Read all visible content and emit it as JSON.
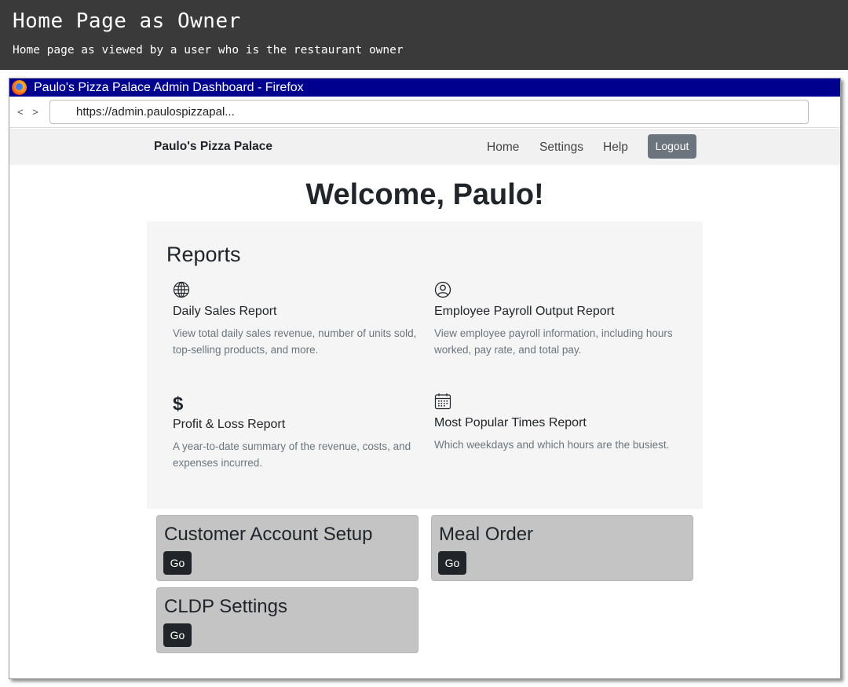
{
  "doc": {
    "title": "Home Page as Owner",
    "subtitle": "Home page as viewed by a user who is the restaurant owner"
  },
  "window": {
    "title": "Paulo's Pizza Palace Admin Dashboard - Firefox",
    "nav_arrows": "< >",
    "url": "https://admin.paulospizzapal..."
  },
  "navbar": {
    "brand": "Paulo's Pizza Palace",
    "links": [
      "Home",
      "Settings",
      "Help"
    ],
    "logout": "Logout"
  },
  "welcome": "Welcome, Paulo!",
  "reports": {
    "title": "Reports",
    "items": [
      {
        "icon": "globe-icon",
        "name": "Daily Sales Report",
        "description": "View total daily sales revenue, number of units sold, top-selling products, and more."
      },
      {
        "icon": "person-circle-icon",
        "name": "Employee Payroll Output Report",
        "description": "View employee payroll information, including hours worked, pay rate, and total pay."
      },
      {
        "icon": "dollar-icon",
        "name": "Profit & Loss Report",
        "description": "A year-to-date summary of the revenue, costs, and expenses incurred."
      },
      {
        "icon": "calendar-icon",
        "name": "Most Popular Times Report",
        "description": "Which weekdays and which hours are the busiest."
      }
    ]
  },
  "cards": [
    {
      "title": "Customer Account Setup",
      "button": "Go"
    },
    {
      "title": "Meal Order",
      "button": "Go"
    },
    {
      "title": "CLDP Settings",
      "button": "Go"
    }
  ],
  "colors": {
    "doc_header_bg": "#3a3a3a",
    "titlebar_bg": "#00008f",
    "navbar_bg": "#f1f1f1",
    "logout_bg": "#6c757d",
    "reports_bg": "#f5f5f5",
    "card_bg": "#c4c4c4",
    "go_button_bg": "#212529"
  },
  "dollar_symbol": "$"
}
